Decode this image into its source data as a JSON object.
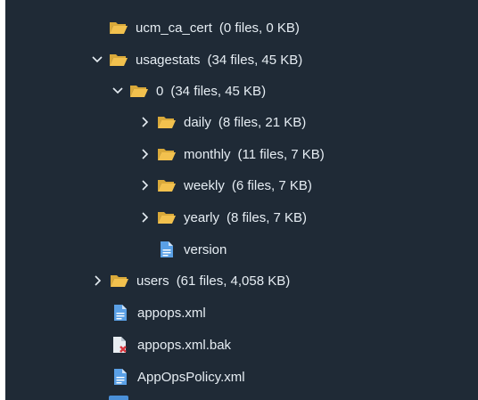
{
  "tree": {
    "rows": [
      {
        "name": "ucm_ca_cert",
        "meta": "(0 files, 0 KB)",
        "type": "folder",
        "chevron": "none",
        "indent": 1
      },
      {
        "name": "usagestats",
        "meta": "(34 files, 45 KB)",
        "type": "folder",
        "chevron": "expanded",
        "indent": 1
      },
      {
        "name": "0",
        "meta": "(34 files, 45 KB)",
        "type": "folder",
        "chevron": "expanded",
        "indent": 2
      },
      {
        "name": "daily",
        "meta": "(8 files, 21 KB)",
        "type": "folder",
        "chevron": "collapsed",
        "indent": 3
      },
      {
        "name": "monthly",
        "meta": "(11 files, 7 KB)",
        "type": "folder",
        "chevron": "collapsed",
        "indent": 3
      },
      {
        "name": "weekly",
        "meta": "(6 files, 7 KB)",
        "type": "folder",
        "chevron": "collapsed",
        "indent": 3
      },
      {
        "name": "yearly",
        "meta": "(8 files, 7 KB)",
        "type": "folder",
        "chevron": "collapsed",
        "indent": 3
      },
      {
        "name": "version",
        "meta": "",
        "type": "file",
        "chevron": "none",
        "indent": 3
      },
      {
        "name": "users",
        "meta": "(61 files, 4,058 KB)",
        "type": "folder",
        "chevron": "collapsed",
        "indent": 0
      },
      {
        "name": "appops.xml",
        "meta": "",
        "type": "file",
        "chevron": "none",
        "indent": 0
      },
      {
        "name": "appops.xml.bak",
        "meta": "",
        "type": "file-error",
        "chevron": "none",
        "indent": 0
      },
      {
        "name": "AppOpsPolicy.xml",
        "meta": "",
        "type": "file",
        "chevron": "none",
        "indent": 0
      }
    ]
  },
  "colors": {
    "background": "#1f2a36",
    "text": "#e6edf3",
    "folder": "#f2c14e",
    "file": "#5aa0e6",
    "error": "#d9363e"
  },
  "icons": {
    "folder": "folder-open-icon",
    "file": "file-icon",
    "file-error": "file-error-icon",
    "expanded": "chevron-down-icon",
    "collapsed": "chevron-right-icon"
  }
}
